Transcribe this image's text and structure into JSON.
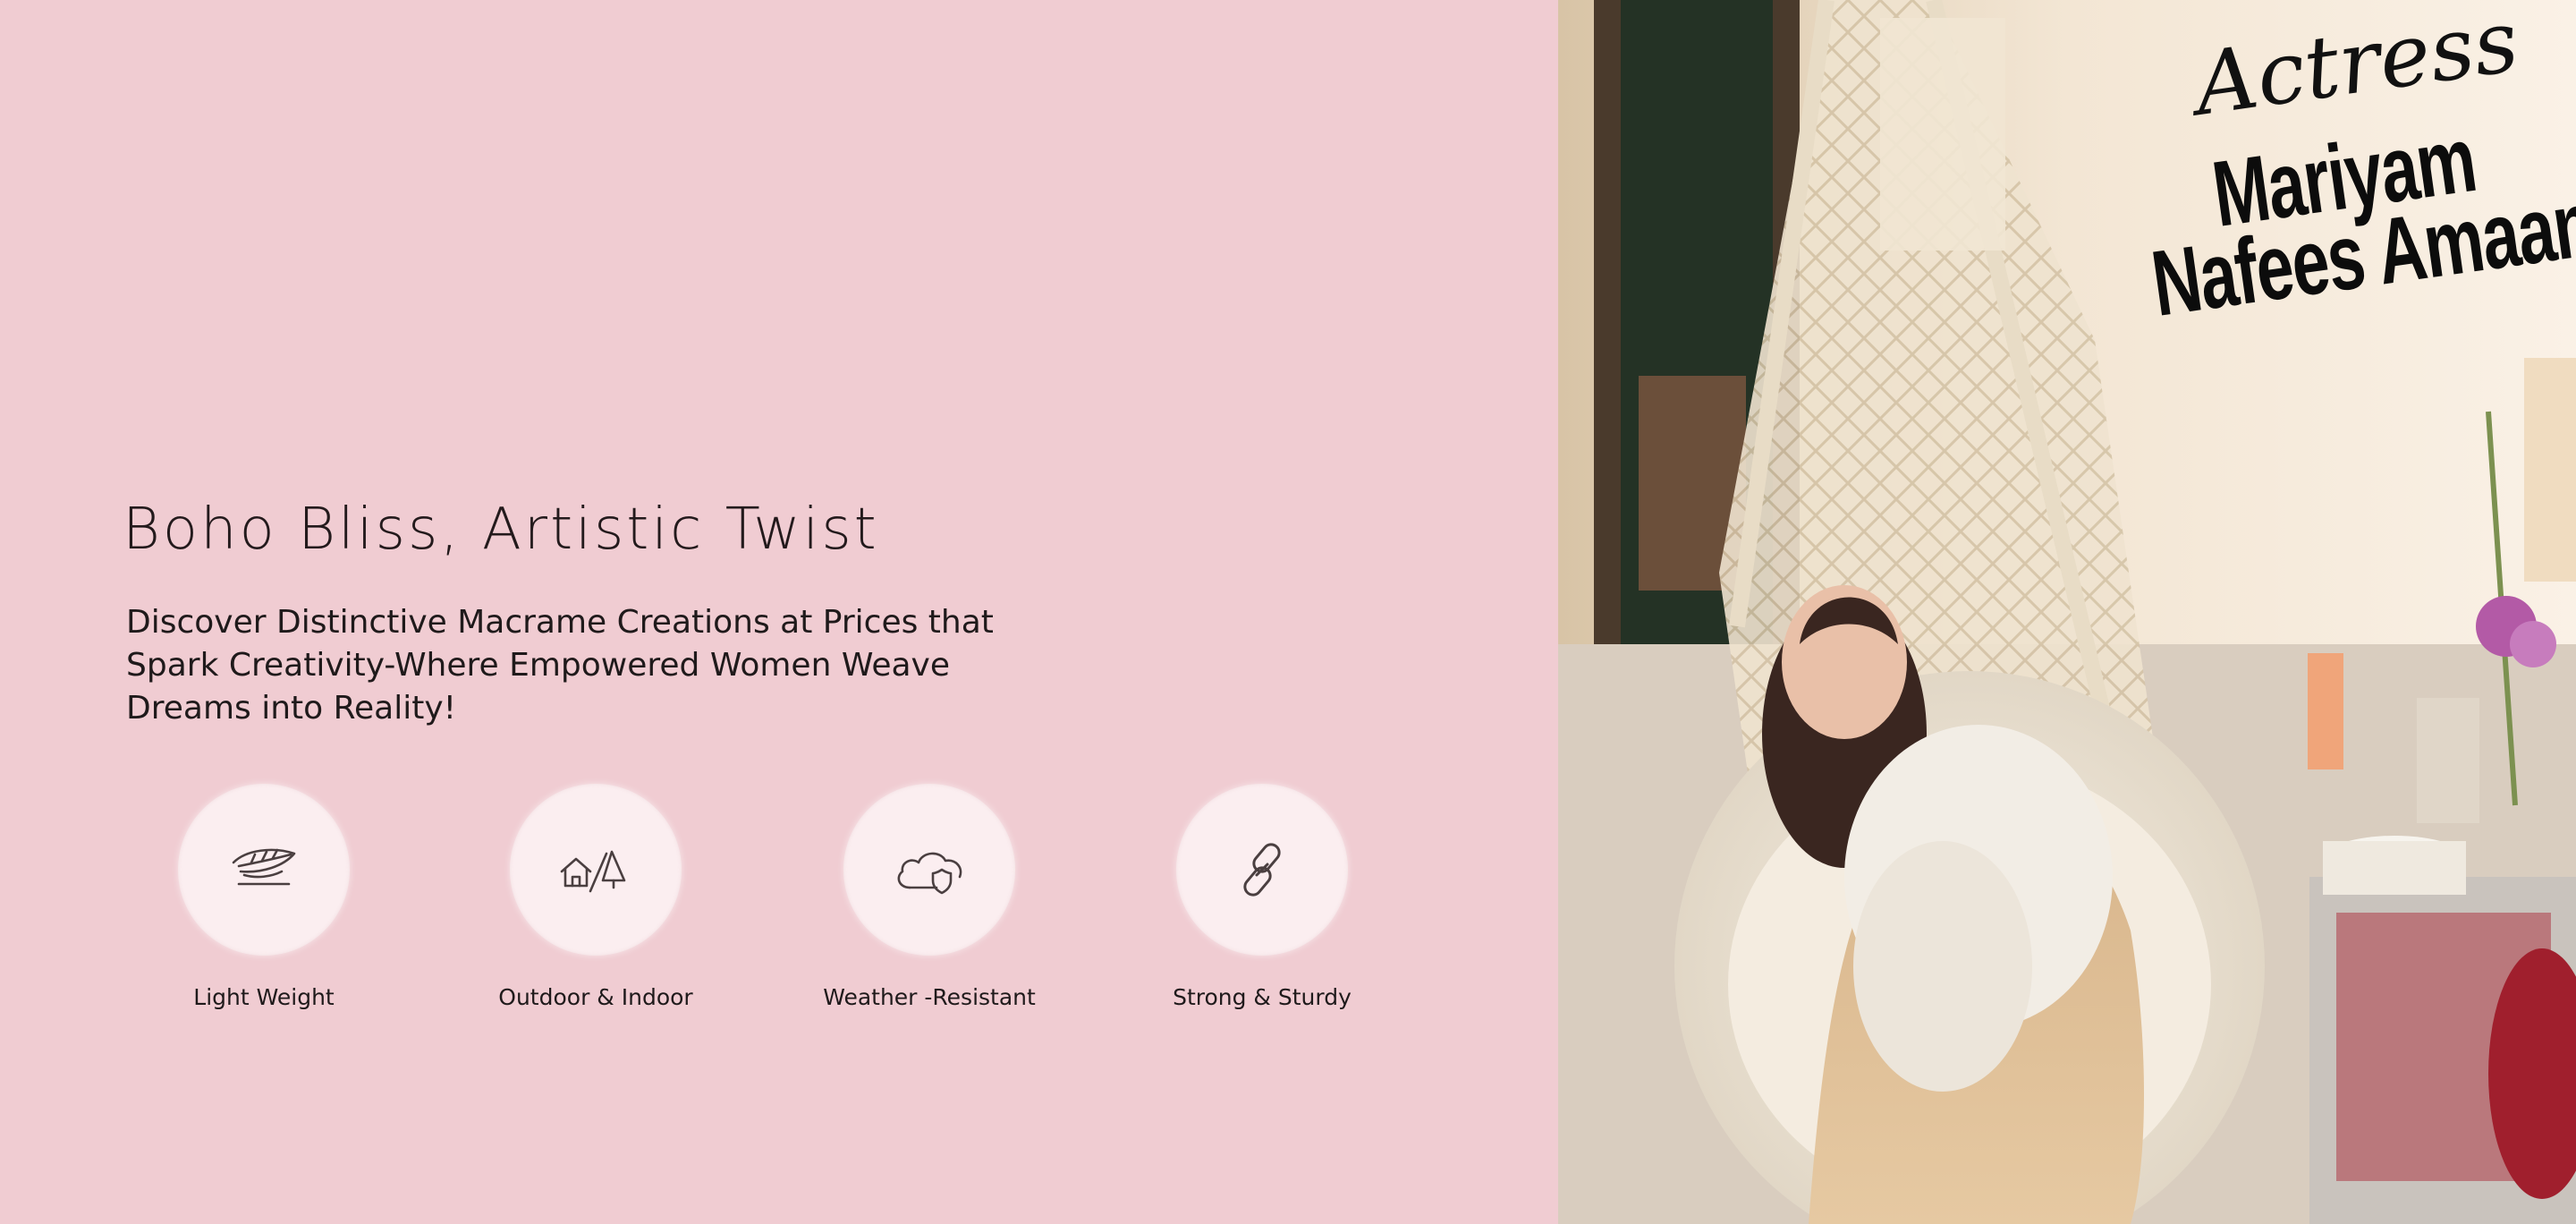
{
  "hero": {
    "heading": "Boho Bliss, Artistic Twist",
    "tagline": "Discover Distinctive Macrame Creations at Prices that Spark Creativity-Where Empowered Women Weave Dreams into Reality!"
  },
  "features": [
    {
      "label": "Light Weight",
      "icon": "feather-icon"
    },
    {
      "label": "Outdoor & Indoor",
      "icon": "house-tree-icon"
    },
    {
      "label": "Weather -Resistant",
      "icon": "cloud-icon"
    },
    {
      "label": "Strong & Sturdy",
      "icon": "chain-link-icon"
    }
  ],
  "photo": {
    "overlay_line1": "Actress",
    "overlay_line2": "Mariyam",
    "overlay_line3": "Nafees Amaan"
  },
  "colors": {
    "background": "#f0ccd2",
    "icon_circle": "#fbeef0",
    "text": "#1f1a1b",
    "icon_stroke": "#4a3f40"
  }
}
